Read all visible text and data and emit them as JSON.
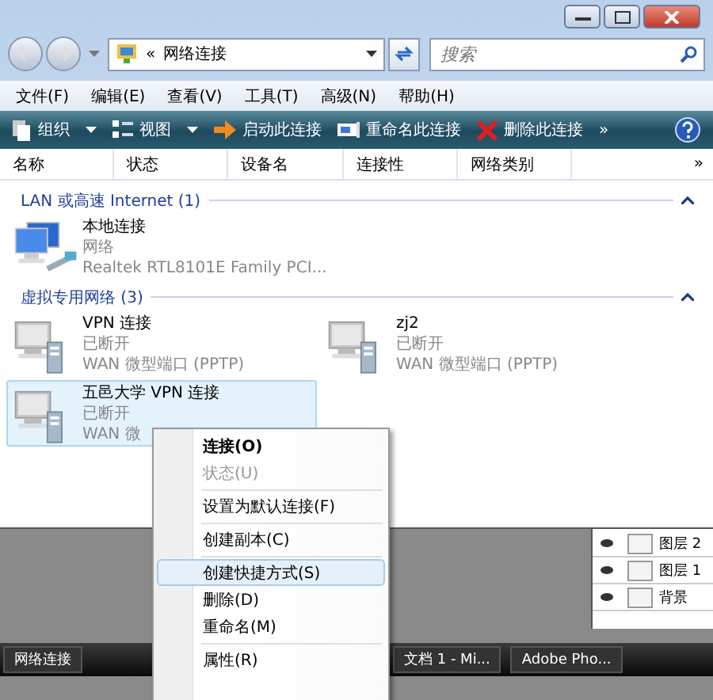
{
  "address": {
    "prefix": "«",
    "path": "网络连接"
  },
  "search": {
    "placeholder": "搜索"
  },
  "menu": [
    "文件(F)",
    "编辑(E)",
    "查看(V)",
    "工具(T)",
    "高级(N)",
    "帮助(H)"
  ],
  "toolbar": [
    {
      "label": "组织",
      "kind": "organize"
    },
    {
      "label": "视图",
      "kind": "views"
    },
    {
      "label": "启动此连接",
      "kind": "start"
    },
    {
      "label": "重命名此连接",
      "kind": "rename"
    },
    {
      "label": "删除此连接",
      "kind": "delete"
    }
  ],
  "toolbar_more": "»",
  "columns": [
    "名称",
    "状态",
    "设备名",
    "连接性",
    "网络类别"
  ],
  "columns_more": "»",
  "groups": [
    {
      "title": "LAN 或高速 Internet (1)",
      "expanded": true,
      "items": [
        {
          "name": "本地连接",
          "status": "网络",
          "device": "Realtek RTL8101E Family PCI...",
          "kind": "lan",
          "selected": false
        }
      ]
    },
    {
      "title": "虚拟专用网络 (3)",
      "expanded": true,
      "items": [
        {
          "name": "VPN 连接",
          "status": "已断开",
          "device": "WAN 微型端口 (PPTP)",
          "kind": "vpn",
          "selected": false
        },
        {
          "name": "zj2",
          "status": "已断开",
          "device": "WAN 微型端口 (PPTP)",
          "kind": "vpn",
          "selected": false
        },
        {
          "name": "五邑大学 VPN 连接",
          "status": "已断开",
          "device": "WAN 微",
          "kind": "vpn",
          "selected": true
        }
      ]
    }
  ],
  "layers": [
    "图层 2",
    "图层 1",
    "背景"
  ],
  "taskbar": [
    "网络连接",
    "文档 1 - Mi...",
    "Adobe Pho..."
  ],
  "context_menu": [
    {
      "kind": "item",
      "label": "连接(O)",
      "default": true,
      "disabled": false,
      "selected": false
    },
    {
      "kind": "item",
      "label": "状态(U)",
      "default": false,
      "disabled": true,
      "selected": false
    },
    {
      "kind": "separator"
    },
    {
      "kind": "item",
      "label": "设置为默认连接(F)",
      "default": false,
      "disabled": false,
      "selected": false
    },
    {
      "kind": "separator"
    },
    {
      "kind": "item",
      "label": "创建副本(C)",
      "default": false,
      "disabled": false,
      "selected": false
    },
    {
      "kind": "separator"
    },
    {
      "kind": "item",
      "label": "创建快捷方式(S)",
      "default": false,
      "disabled": false,
      "selected": true
    },
    {
      "kind": "item",
      "label": "删除(D)",
      "default": false,
      "disabled": false,
      "selected": false
    },
    {
      "kind": "item",
      "label": "重命名(M)",
      "default": false,
      "disabled": false,
      "selected": false
    },
    {
      "kind": "separator"
    },
    {
      "kind": "item",
      "label": "属性(R)",
      "default": false,
      "disabled": false,
      "selected": false
    }
  ]
}
